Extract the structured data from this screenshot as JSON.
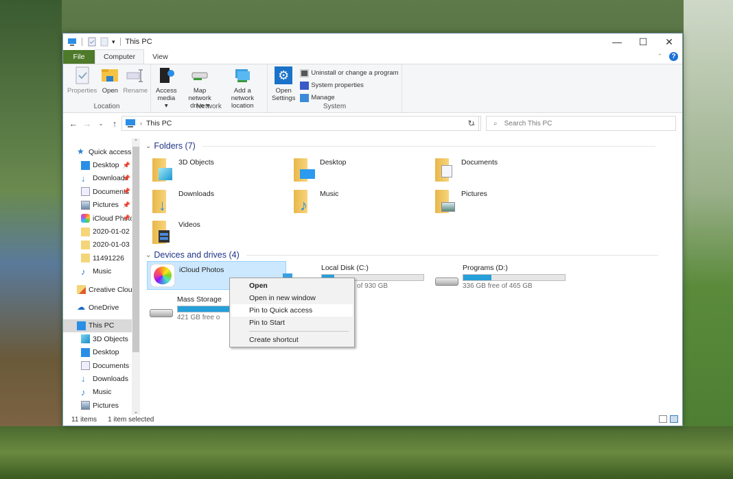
{
  "window": {
    "title": "This PC",
    "controls": {
      "minimize": "—",
      "maximize": "☐",
      "close": "✕"
    }
  },
  "tabs": [
    {
      "label": "File"
    },
    {
      "label": "Computer"
    },
    {
      "label": "View"
    }
  ],
  "ribbon": {
    "location": {
      "label": "Location",
      "buttons": [
        {
          "label": "Properties",
          "icon": "properties-icon"
        },
        {
          "label": "Open",
          "icon": "open-folder-icon"
        },
        {
          "label": "Rename",
          "icon": "rename-icon"
        }
      ]
    },
    "network": {
      "label": "Network",
      "buttons": [
        {
          "label": "Access\nmedia ▾",
          "line1": "Access",
          "line2": "media ▾"
        },
        {
          "line1": "Map network",
          "line2": "drive ▾"
        },
        {
          "line1": "Add a network",
          "line2": "location"
        }
      ]
    },
    "system": {
      "label": "System",
      "open_settings_line1": "Open",
      "open_settings_line2": "Settings",
      "items": [
        {
          "label": "Uninstall or change a program"
        },
        {
          "label": "System properties"
        },
        {
          "label": "Manage"
        }
      ]
    }
  },
  "navbar": {
    "back": "←",
    "forward": "→",
    "recent": "⌄",
    "up": "↑",
    "breadcrumb": "This PC",
    "search_placeholder": "Search This PC"
  },
  "sidebar": {
    "items": [
      {
        "label": "Quick access",
        "pinned": false
      },
      {
        "label": "Desktop",
        "pinned": true
      },
      {
        "label": "Downloads",
        "pinned": true
      },
      {
        "label": "Documents",
        "pinned": true
      },
      {
        "label": "Pictures",
        "pinned": true
      },
      {
        "label": "iCloud Photo",
        "pinned": true
      },
      {
        "label": "2020-01-02",
        "pinned": false
      },
      {
        "label": "2020-01-03",
        "pinned": false
      },
      {
        "label": "11491226",
        "pinned": false
      },
      {
        "label": "Music",
        "pinned": false
      },
      {
        "label": "Creative Cloud Fil",
        "pinned": false
      },
      {
        "label": "OneDrive",
        "pinned": false
      },
      {
        "label": "This PC",
        "pinned": false,
        "selected": true
      },
      {
        "label": "3D Objects"
      },
      {
        "label": "Desktop"
      },
      {
        "label": "Documents"
      },
      {
        "label": "Downloads"
      },
      {
        "label": "Music"
      },
      {
        "label": "Pictures"
      }
    ]
  },
  "content": {
    "folders_header": "Folders (7)",
    "folders": [
      {
        "name": "3D Objects"
      },
      {
        "name": "Desktop"
      },
      {
        "name": "Documents"
      },
      {
        "name": "Downloads"
      },
      {
        "name": "Music"
      },
      {
        "name": "Pictures"
      },
      {
        "name": "Videos"
      }
    ],
    "drives_header": "Devices and drives (4)",
    "drives": [
      {
        "name": "iCloud Photos",
        "selected": true
      },
      {
        "name": "Local Disk (C:)",
        "free_text": "free of 930 GB",
        "used_fraction": 0.12
      },
      {
        "name": "Programs (D:)",
        "free_text": "336 GB free of 465 GB",
        "used_fraction": 0.28
      },
      {
        "name": "Mass Storage",
        "free_text": "421 GB free o",
        "used_fraction": 0.8
      }
    ]
  },
  "context_menu": {
    "items": [
      {
        "label": "Open",
        "bold": true
      },
      {
        "label": "Open in new window"
      },
      {
        "label": "Pin to Quick access",
        "highlighted": true
      },
      {
        "label": "Pin to Start"
      },
      {
        "label": "Create shortcut"
      }
    ]
  },
  "status": {
    "items_count": "11 items",
    "selected": "1 item selected"
  },
  "colors": {
    "file_tab": "#4e7a2a",
    "accent": "#26a0da",
    "selection": "#cce8ff",
    "header_text": "#1e3287"
  }
}
